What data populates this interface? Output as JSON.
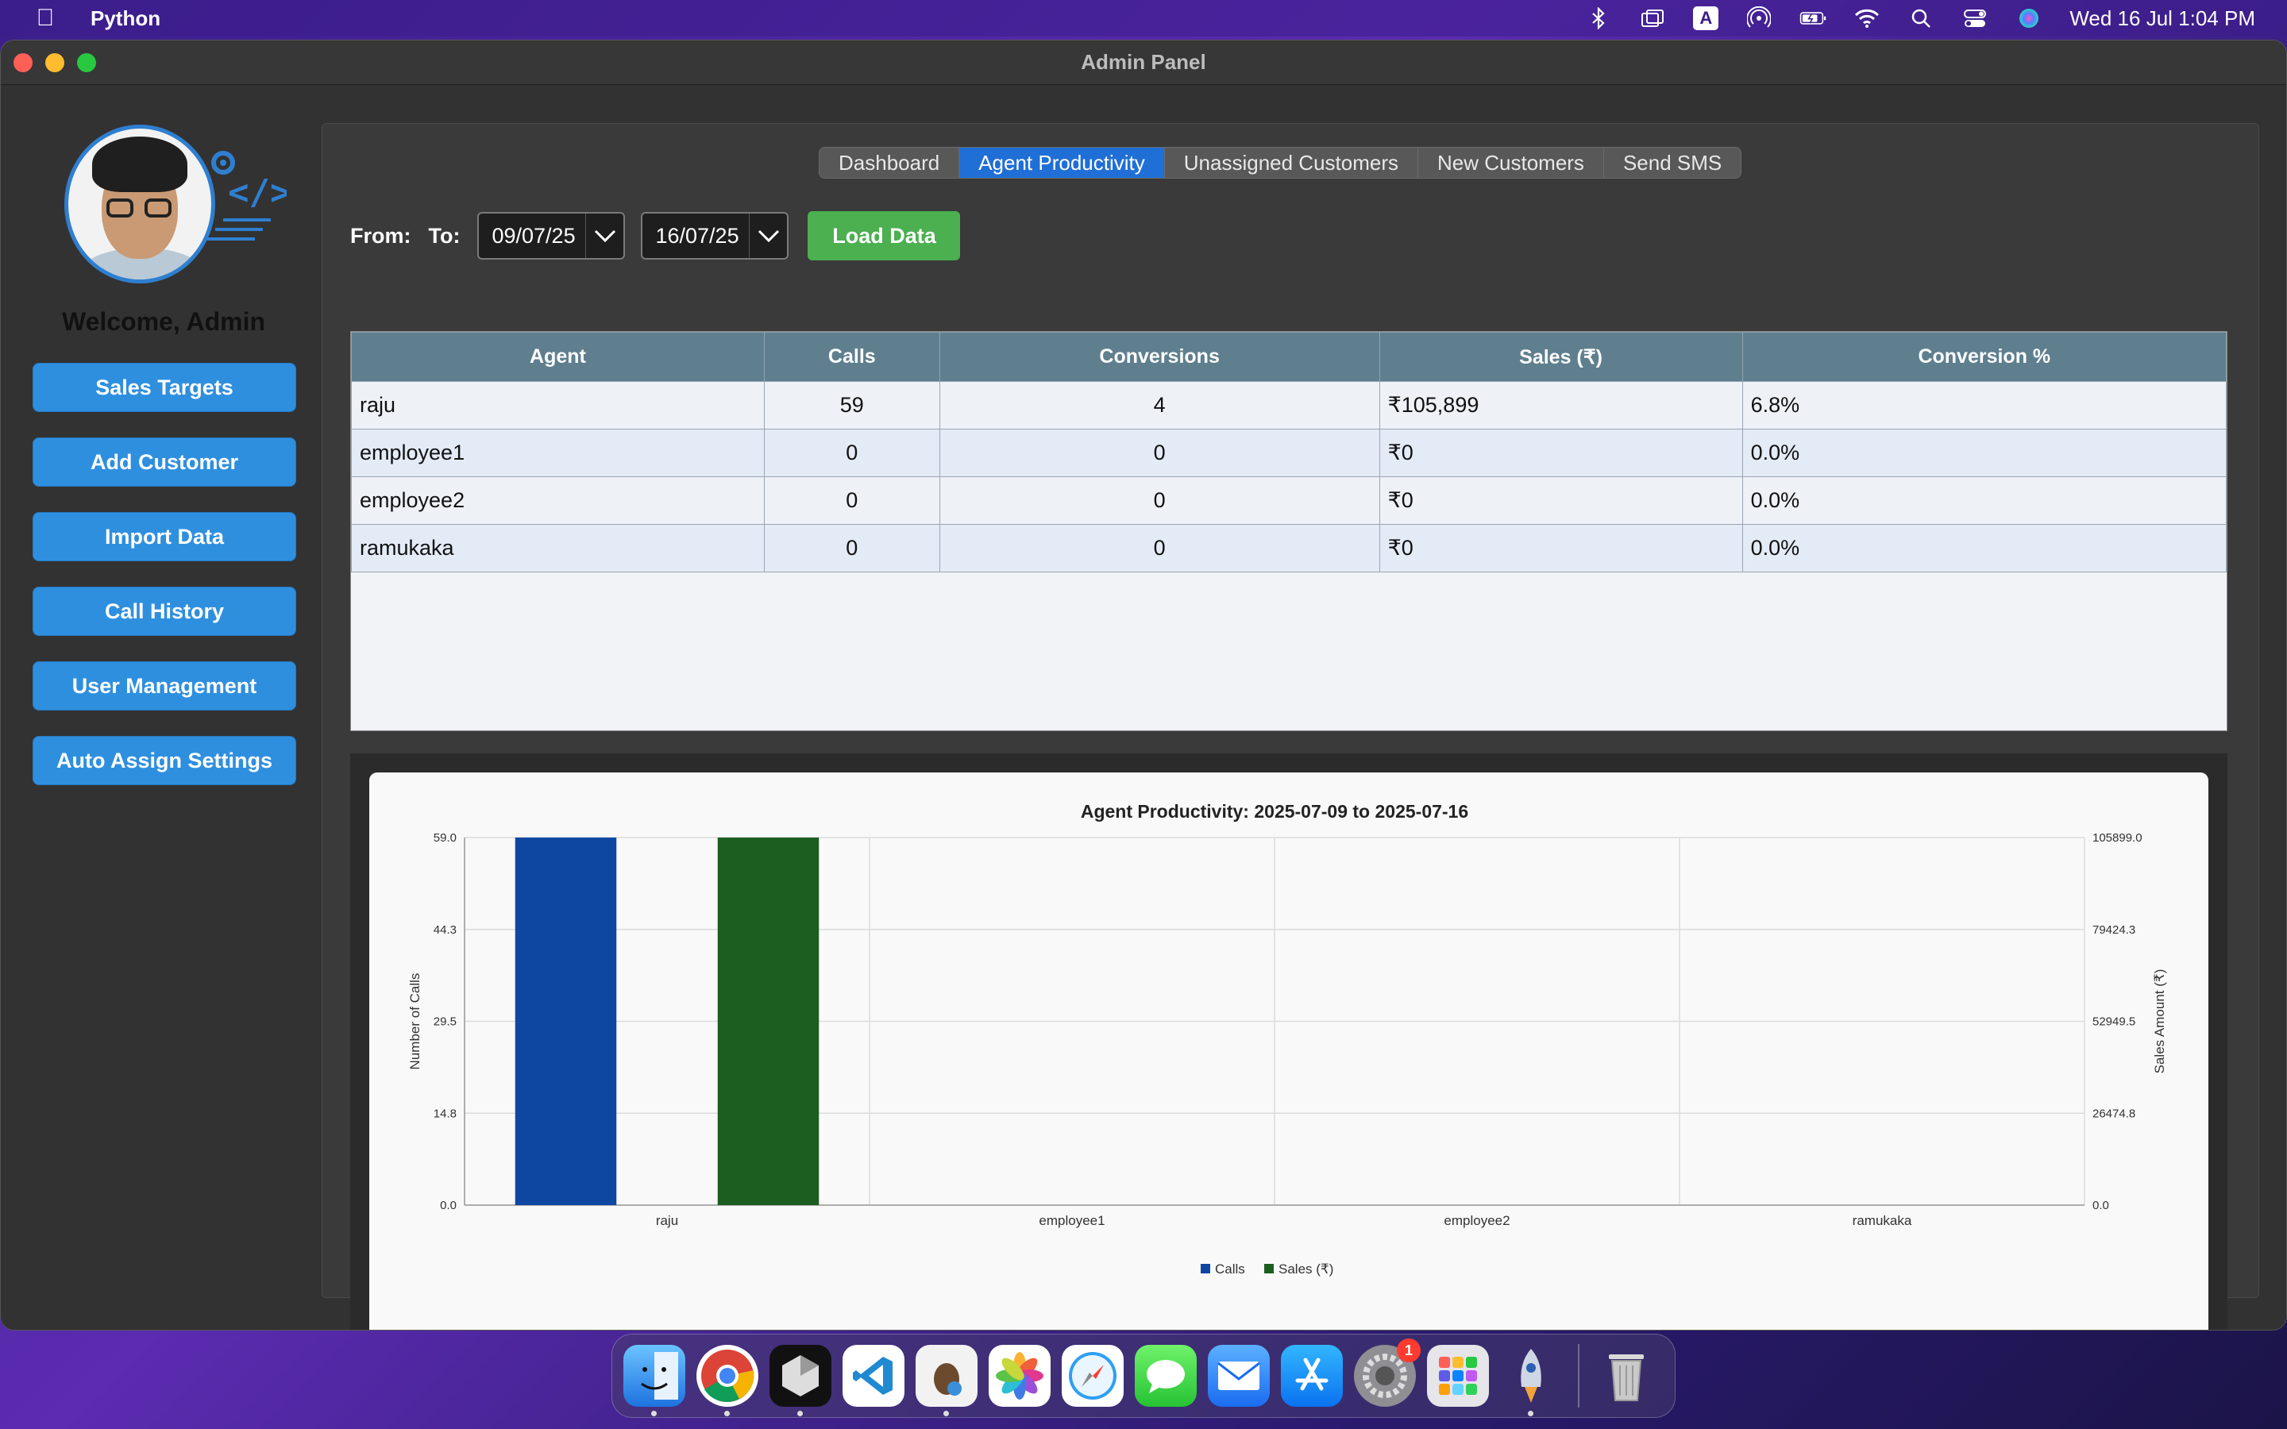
{
  "menubar": {
    "app_name": "Python",
    "clock": "Wed 16 Jul  1:04 PM",
    "icons": [
      "apple-icon",
      "bluetooth-icon",
      "screen-mirror-icon",
      "input-source-icon",
      "airdrop-icon",
      "battery-icon",
      "wifi-icon",
      "search-icon",
      "control-center-icon",
      "siri-icon"
    ],
    "input_source_label": "A"
  },
  "window": {
    "title": "Admin Panel"
  },
  "sidebar": {
    "welcome": "Welcome, Admin",
    "buttons": [
      "Sales Targets",
      "Add Customer",
      "Import Data",
      "Call History",
      "User Management",
      "Auto Assign Settings"
    ]
  },
  "tabs": [
    {
      "label": "Dashboard",
      "active": false
    },
    {
      "label": "Agent Productivity",
      "active": true
    },
    {
      "label": "Unassigned Customers",
      "active": false
    },
    {
      "label": "New Customers",
      "active": false
    },
    {
      "label": "Send SMS",
      "active": false
    }
  ],
  "filters": {
    "from_label": "From:",
    "to_label": "To:",
    "from_value": "09/07/25",
    "to_value": "16/07/25",
    "load_button": "Load Data"
  },
  "table": {
    "headers": [
      "Agent",
      "Calls",
      "Conversions",
      "Sales (₹)",
      "Conversion %"
    ],
    "rows": [
      [
        "raju",
        "59",
        "4",
        "₹105,899",
        "6.8%"
      ],
      [
        "employee1",
        "0",
        "0",
        "₹0",
        "0.0%"
      ],
      [
        "employee2",
        "0",
        "0",
        "₹0",
        "0.0%"
      ],
      [
        "ramukaka",
        "0",
        "0",
        "₹0",
        "0.0%"
      ]
    ]
  },
  "chart_data": {
    "type": "bar",
    "title": "Agent Productivity: 2025-07-09 to 2025-07-16",
    "categories": [
      "raju",
      "employee1",
      "employee2",
      "ramukaka"
    ],
    "series": [
      {
        "name": "Calls",
        "axis": "left",
        "color": "#0d47a1",
        "values": [
          59,
          0,
          0,
          0
        ]
      },
      {
        "name": "Sales (₹)",
        "axis": "right",
        "color": "#1b5e20",
        "values": [
          105899,
          0,
          0,
          0
        ]
      }
    ],
    "ylabel": "Number of Calls",
    "y2label": "Sales Amount (₹)",
    "ylim": [
      0,
      59
    ],
    "y2lim": [
      0,
      105899
    ],
    "yticks": [
      "0.0",
      "14.8",
      "29.5",
      "44.3",
      "59.0"
    ],
    "y2ticks": [
      "0.0",
      "26474.8",
      "52949.5",
      "79424.3",
      "105899.0"
    ],
    "grid": true,
    "legend_position": "bottom-center"
  },
  "dock": {
    "apps": [
      "finder-icon",
      "chrome-icon",
      "cursor-icon",
      "vscode-icon",
      "sequel-ace-icon",
      "photos-icon",
      "safari-icon",
      "messages-icon",
      "mail-icon",
      "app-store-icon",
      "system-settings-icon",
      "launchpad-icon",
      "rocket-icon",
      "trash-icon"
    ],
    "settings_badge": "1"
  }
}
